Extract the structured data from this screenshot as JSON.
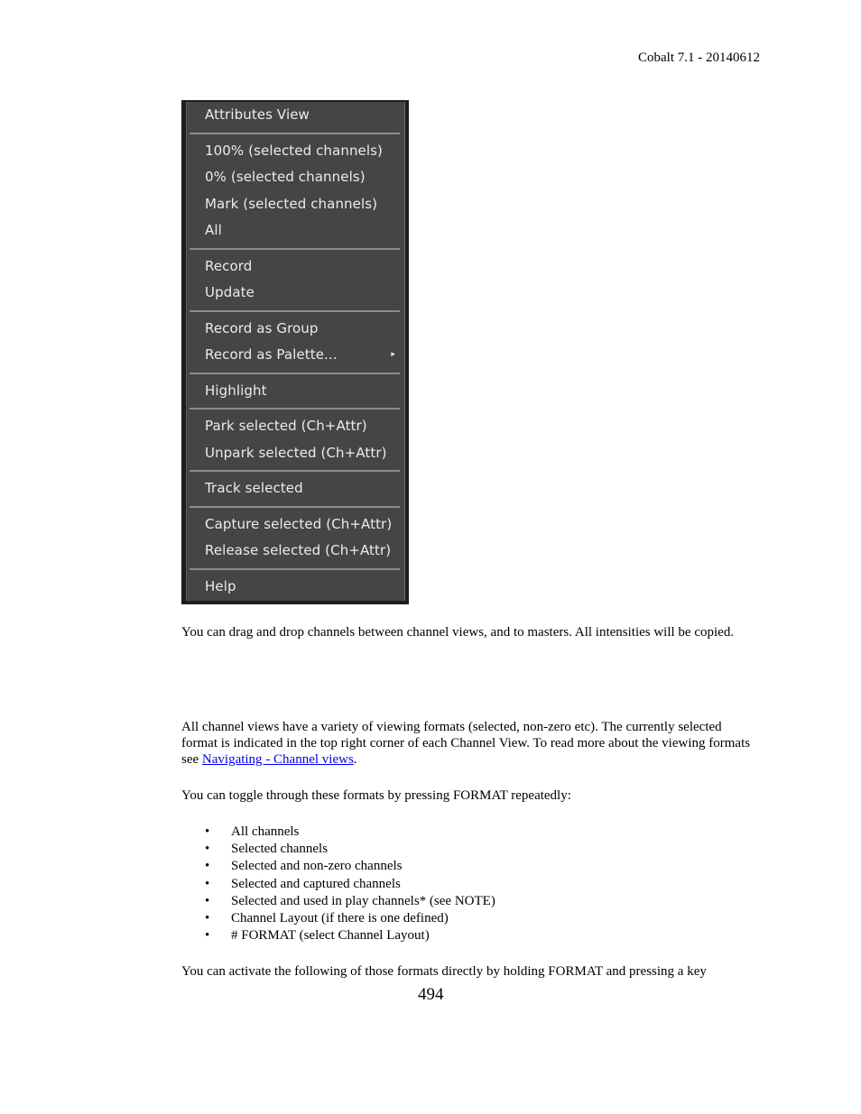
{
  "header": {
    "doc_version": "Cobalt 7.1 - 20140612"
  },
  "context_menu": {
    "groups": [
      [
        {
          "label": "Attributes View"
        }
      ],
      [
        {
          "label": "100% (selected channels)"
        },
        {
          "label": "0% (selected channels)"
        },
        {
          "label": "Mark (selected channels)"
        },
        {
          "label": "All"
        }
      ],
      [
        {
          "label": "Record"
        },
        {
          "label": "Update"
        }
      ],
      [
        {
          "label": "Record as Group"
        },
        {
          "label": "Record as Palette...",
          "submenu": true,
          "submenu_icon": "▸"
        }
      ],
      [
        {
          "label": "Highlight"
        }
      ],
      [
        {
          "label": "Park selected (Ch+Attr)"
        },
        {
          "label": "Unpark selected (Ch+Attr)"
        }
      ],
      [
        {
          "label": "Track selected"
        }
      ],
      [
        {
          "label": "Capture selected (Ch+Attr)"
        },
        {
          "label": "Release selected (Ch+Attr)"
        }
      ],
      [
        {
          "label": "Help"
        }
      ]
    ]
  },
  "body": {
    "drag_drop_text": "You can drag and drop channels between channel views, and to masters. All intensities will be copied.",
    "formats_intro_before_link": "All channel views have a variety of viewing formats (selected, non-zero etc). The currently selected format is indicated in the top right corner of each Channel View. To read more about the viewing formats see ",
    "formats_link": "Navigating - Channel views",
    "formats_intro_after_link": ".",
    "toggle_text": "You can toggle through these formats by pressing FORMAT repeatedly:",
    "bullet_glyph": "•",
    "formats": [
      "All channels",
      "Selected channels",
      "Selected and non-zero channels",
      "Selected and captured channels",
      "Selected and used in play channels* (see NOTE)",
      "Channel Layout (if there is one defined)",
      "# FORMAT (select Channel Layout)"
    ],
    "activate_text": "You can activate the following of those formats directly by holding FORMAT and pressing a key"
  },
  "footer": {
    "page_number": "494"
  }
}
